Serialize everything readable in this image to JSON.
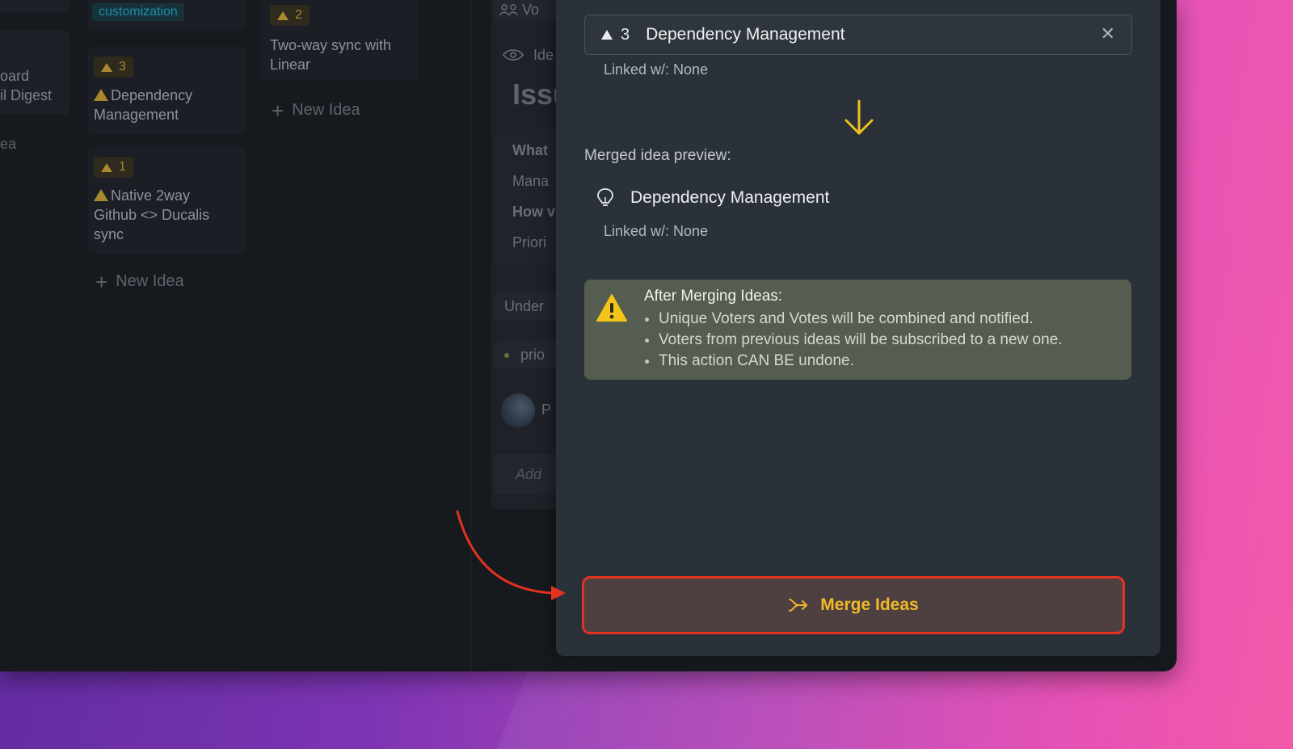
{
  "board": {
    "left_column": {
      "fragment_1": "oard",
      "fragment_2": "il Digest",
      "fragment_3": "ea"
    },
    "column_2": {
      "tag": "customization",
      "cards": [
        {
          "votes": "3",
          "title": "Dependency Management"
        },
        {
          "votes": "1",
          "title": "Native 2way Github <> Ducalis sync"
        }
      ],
      "new_idea": "New Idea"
    },
    "column_3": {
      "cards": [
        {
          "votes": "2",
          "title": "Two-way sync with Linear"
        }
      ],
      "new_idea": "New Idea"
    },
    "detail_panel": {
      "voters": "Vo",
      "ideas": "Ide",
      "heading": "Issu",
      "what": "What",
      "mana": "Mana",
      "how": "How v",
      "priori": "Priori",
      "under": "Under",
      "prio": "prio",
      "author": "P",
      "add": "Add"
    }
  },
  "modal": {
    "source": {
      "votes": "3",
      "title": "Dependency Management",
      "close": "✕",
      "linked": "Linked w/: None"
    },
    "preview_label": "Merged idea preview:",
    "preview": {
      "title": "Dependency Management",
      "linked": "Linked w/: None"
    },
    "notice": {
      "title": "After Merging Ideas:",
      "items": [
        "Unique Voters and Votes will be combined and notified.",
        "Voters from previous ideas will be subscribed to a new one.",
        "This action CAN BE undone."
      ]
    },
    "merge_button": "Merge Ideas"
  },
  "colors": {
    "accent_yellow": "#f0b82b",
    "highlight_red": "#e3321f",
    "modal_bg": "#2b3139",
    "notice_bg": "#545d50"
  },
  "icons": [
    "triangle-up-icon",
    "close-icon",
    "arrow-down-icon",
    "lightbulb-icon",
    "warning-icon",
    "merge-icon",
    "plus-icon",
    "eye-icon",
    "people-icon",
    "pointer-arrow-icon"
  ]
}
